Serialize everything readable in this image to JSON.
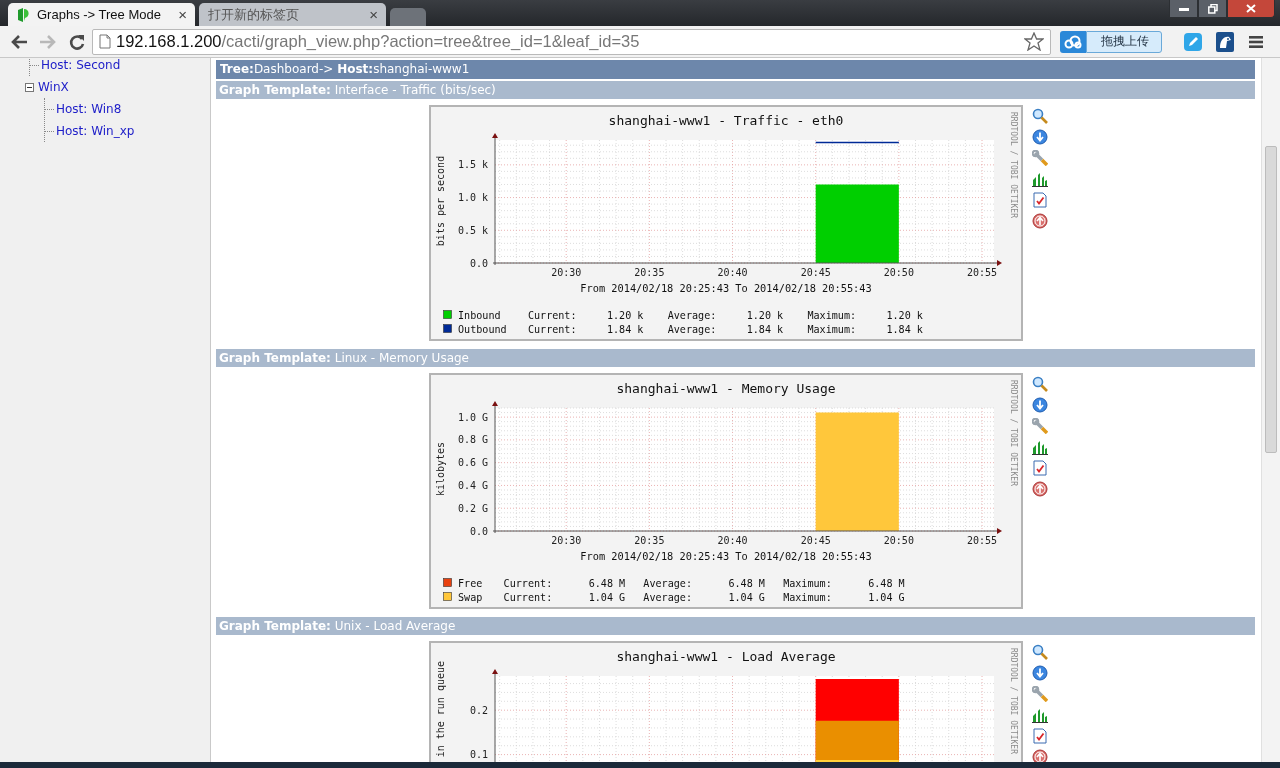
{
  "browser": {
    "tabs": [
      {
        "title": "Graphs -> Tree Mode",
        "close": "×",
        "selected": true
      },
      {
        "title": "打开新的标签页",
        "close": "×",
        "selected": false
      }
    ],
    "nav": [
      {
        "kind": "back",
        "disabled": false
      },
      {
        "kind": "forward",
        "disabled": true
      },
      {
        "kind": "reload",
        "disabled": false
      }
    ],
    "url": {
      "host": "192.168.1.200",
      "path": "/cacti/graph_view.php?action=tree&tree_id=1&leaf_id=35"
    },
    "upload_popup": "拖拽上传"
  },
  "sidebar": {
    "tree": [
      {
        "children": [
          {
            "label": "Host: Second"
          }
        ]
      },
      {
        "label": "WinX",
        "expanded": true,
        "children": [
          {
            "label": "Host: Win8"
          },
          {
            "label": "Host: Win_xp"
          }
        ]
      }
    ]
  },
  "breadcrumb": "**Tree:**Dashboard-> **Host:**shanghai-www1",
  "graphs": [
    {
      "template": "**Graph Template:** Interface - Traffic (bits/sec)",
      "credit": "RRDTOOL / TOBI OETIKER",
      "period": "From 2014/02/18 20:25:43 To 2014/02/18 20:55:43",
      "legend": [
        {
          "stats": "Current:     1.20 k    Average:     1.20 k    Maximum:     1.20 k"
        },
        {
          "stats": "Current:     1.84 k    Average:     1.84 k    Maximum:     1.84 k"
        }
      ],
      "chart_data": {
        "type": "area",
        "title": "shanghai-www1 - Traffic - eth0",
        "ylabel": "bits per second",
        "grid": true,
        "legend": "bottom",
        "ylim": [
          0,
          1.88
        ],
        "categories": [
          "20:30",
          "20:35",
          "20:40",
          "20:45",
          "20:50",
          "20:55"
        ],
        "yticks": [
          {
            "value": 0,
            "label": "0.0"
          },
          {
            "value": 0.5,
            "label": "0.5 k"
          },
          {
            "value": 1,
            "label": "1.0 k"
          },
          {
            "value": 1.5,
            "label": "1.5 k"
          }
        ],
        "series": [
          {
            "name": "Inbound",
            "color": "#00cf00",
            "type": "area",
            "values": [
              null,
              null,
              null,
              1.2,
              1.2,
              null
            ]
          },
          {
            "name": "Outbound",
            "color": "#002a97",
            "type": "line",
            "values": [
              null,
              null,
              null,
              1.84,
              1.84,
              null
            ]
          }
        ]
      }
    },
    {
      "template": "**Graph Template:** Linux - Memory Usage",
      "credit": "RRDTOOL / TOBI OETIKER",
      "period": "From 2014/02/18 20:25:43 To 2014/02/18 20:55:43",
      "legend": [
        {
          "stats": "Current:      6.48 M   Average:      6.48 M   Maximum:      6.48 M"
        },
        {
          "stats": "Current:      1.04 G   Average:      1.04 G   Maximum:      1.04 G"
        }
      ],
      "chart_data": {
        "type": "area",
        "title": "shanghai-www1 - Memory Usage",
        "ylabel": "kilobytes",
        "grid": true,
        "legend": "bottom",
        "ylim": [
          0,
          1.08
        ],
        "categories": [
          "20:30",
          "20:35",
          "20:40",
          "20:45",
          "20:50",
          "20:55"
        ],
        "yticks": [
          {
            "value": 0,
            "label": "0.0"
          },
          {
            "value": 0.2,
            "label": "0.2 G"
          },
          {
            "value": 0.4,
            "label": "0.4 G"
          },
          {
            "value": 0.6,
            "label": "0.6 G"
          },
          {
            "value": 0.8,
            "label": "0.8 G"
          },
          {
            "value": 1,
            "label": "1.0 G"
          }
        ],
        "series": [
          {
            "name": "Free",
            "color": "#e8410f",
            "type": "area",
            "values": [
              null,
              null,
              null,
              0.006,
              0.006,
              null
            ]
          },
          {
            "name": "Swap",
            "color": "#ffc73b",
            "type": "area",
            "values": [
              null,
              null,
              null,
              1.04,
              1.04,
              null
            ]
          }
        ]
      }
    },
    {
      "template": "**Graph Template:** Unix - Load Average",
      "credit": "RRDTOOL / TOBI OETIKER",
      "chart_data": {
        "type": "area",
        "title": "shanghai-www1 - Load Average",
        "ylabel": "in the run queue",
        "grid": true,
        "ylim": [
          0,
          0.277
        ],
        "categories": [
          null,
          null,
          null,
          null,
          null,
          null
        ],
        "yticks": [
          {
            "value": 0.1,
            "label": "0.1"
          },
          {
            "value": 0.2,
            "label": "0.2"
          }
        ],
        "series": [
          {
            "color": "#ff0000",
            "type": "area",
            "values": [
              null,
              null,
              null,
              0.27,
              0.27,
              null
            ]
          },
          {
            "color": "#ea8f00",
            "type": "area",
            "values": [
              null,
              null,
              null,
              0.176,
              0.176,
              null
            ]
          },
          {
            "color": "#ffd23b",
            "type": "area",
            "values": [
              null,
              null,
              null,
              0.088,
              0.088,
              null
            ]
          }
        ]
      }
    }
  ]
}
